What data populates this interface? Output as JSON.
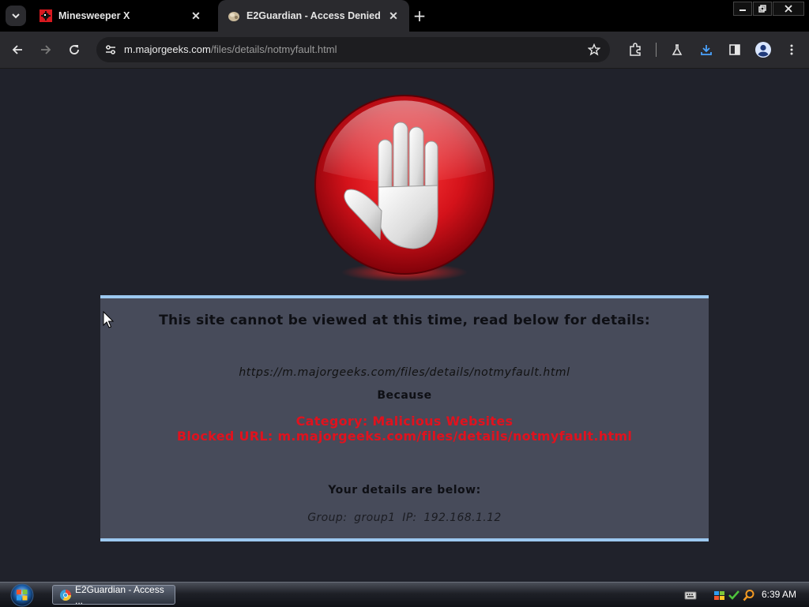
{
  "browser": {
    "tabs": [
      {
        "title": "Minesweeper X",
        "active": false
      },
      {
        "title": "E2Guardian - Access Denied",
        "active": true
      }
    ],
    "address": {
      "host": "m.majorgeeks.com",
      "path": "/files/details/notmyfault.html"
    },
    "icons": [
      "tab-search-icon",
      "back-icon",
      "forward-icon",
      "reload-icon",
      "site-info-icon",
      "bookmark-star-icon",
      "extensions-icon",
      "labs-icon",
      "download-icon",
      "side-panel-icon",
      "profile-icon",
      "menu-icon"
    ]
  },
  "page": {
    "headline": "This site cannot be viewed at this time, read below for details:",
    "blocked_url": "https://m.majorgeeks.com/files/details/notmyfault.html",
    "because": "Because",
    "category_line": "Category: Malicious Websites",
    "blocked_url_line": "Blocked URL: m.majorgeeks.com/files/details/notmyfault.html",
    "details_heading": "Your details are below:",
    "details": "Group: group1   IP: 192.168.1.12"
  },
  "taskbar": {
    "task_label": "E2Guardian - Access ...",
    "clock": "6:39 AM"
  },
  "colors": {
    "page_bg": "#20222b",
    "panel_bg": "#474b5a",
    "panel_border": "#9cc8f0",
    "alert_red": "#e0121e"
  }
}
